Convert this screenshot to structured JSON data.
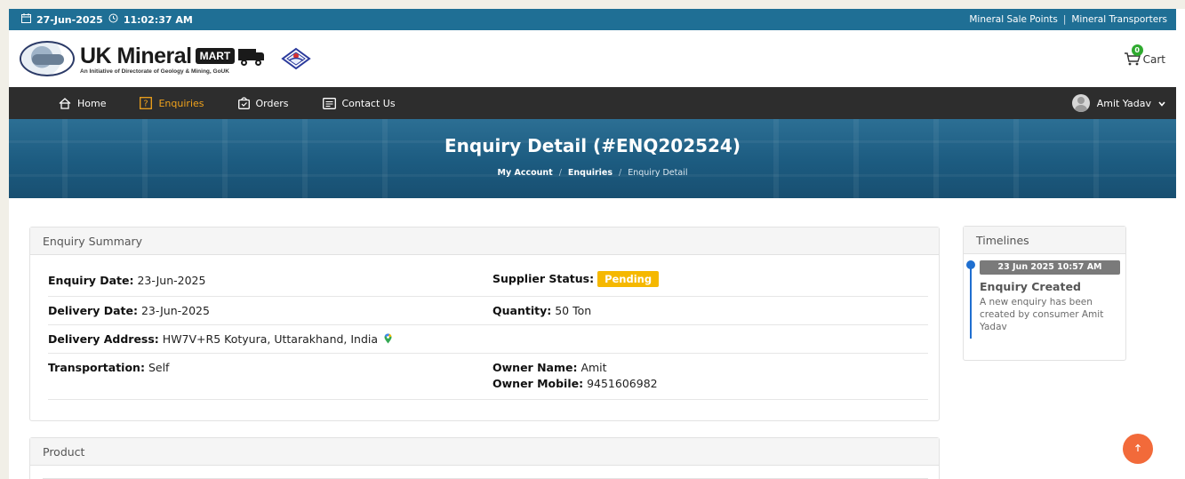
{
  "topbar": {
    "date": "27-Jun-2025",
    "time": "11:02:37 AM",
    "links": [
      "Mineral Sale Points",
      "Mineral Transporters"
    ]
  },
  "brand": {
    "name": "UK Mineral",
    "mart": "MART",
    "tagline": "An Initiative of Directorate of Geology & Mining, GoUK"
  },
  "cart": {
    "label": "Cart",
    "count": "0"
  },
  "nav": {
    "items": [
      {
        "label": "Home",
        "icon": "home-icon"
      },
      {
        "label": "Enquiries",
        "icon": "question-box-icon"
      },
      {
        "label": "Orders",
        "icon": "bag-check-icon"
      },
      {
        "label": "Contact Us",
        "icon": "message-icon"
      }
    ],
    "active": "Enquiries",
    "user": "Amit Yadav"
  },
  "hero": {
    "title": "Enquiry Detail (#ENQ202524)",
    "breadcrumb": [
      "My Account",
      "Enquiries",
      "Enquiry Detail"
    ]
  },
  "summary": {
    "header": "Enquiry Summary",
    "enquiry_date_label": "Enquiry Date:",
    "enquiry_date": "23-Jun-2025",
    "supplier_status_label": "Supplier Status:",
    "supplier_status": "Pending",
    "delivery_date_label": "Delivery Date:",
    "delivery_date": "23-Jun-2025",
    "quantity_label": "Quantity:",
    "quantity": "50 Ton",
    "delivery_address_label": "Delivery Address:",
    "delivery_address": "HW7V+R5 Kotyura, Uttarakhand, India",
    "transportation_label": "Transportation:",
    "transportation": "Self",
    "owner_name_label": "Owner Name:",
    "owner_name": "Amit",
    "owner_mobile_label": "Owner Mobile:",
    "owner_mobile": "9451606982"
  },
  "product": {
    "header": "Product"
  },
  "timelines": {
    "header": "Timelines",
    "entries": [
      {
        "date": "23 Jun 2025 10:57 AM",
        "title": "Enquiry Created",
        "text": "A new enquiry has been created by consumer Amit Yadav"
      }
    ]
  },
  "colors": {
    "topbar": "#1f6f95",
    "nav": "#2d2d2d",
    "active_nav": "#f0a21c",
    "badge": "#f5b800",
    "timeline_accent": "#1f6fd0",
    "scroll_top": "#f26a3a"
  }
}
